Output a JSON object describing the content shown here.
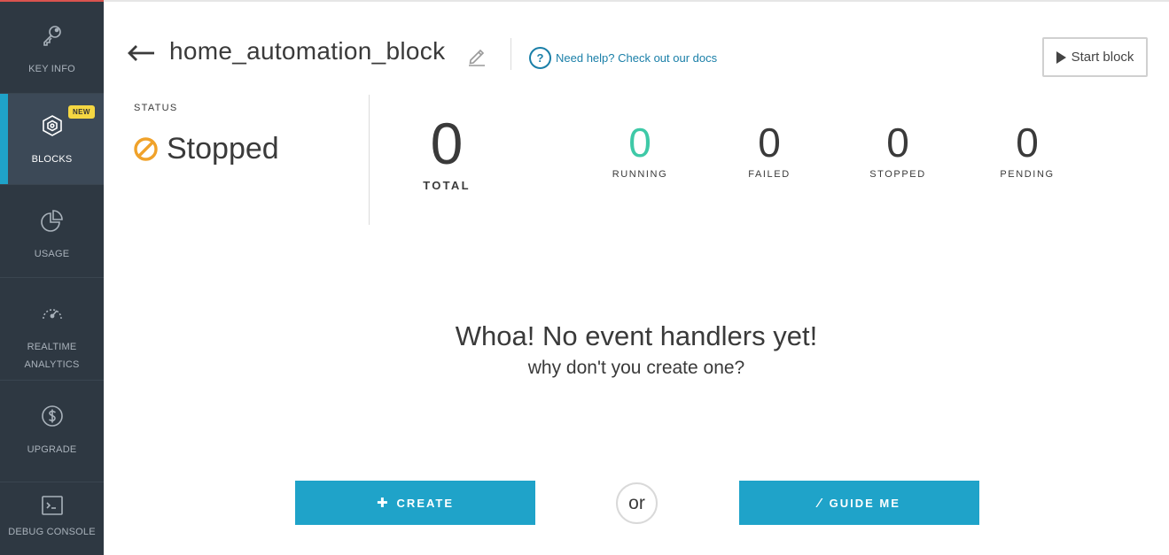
{
  "sidebar": {
    "items": [
      {
        "label": "KEY INFO",
        "icon": "key-icon"
      },
      {
        "label": "BLOCKS",
        "icon": "blocks-icon",
        "badge": "NEW",
        "active": true
      },
      {
        "label": "USAGE",
        "icon": "pie-chart-icon"
      },
      {
        "label": "REALTIME\nANALYTICS",
        "icon": "speedometer-icon"
      },
      {
        "label": "UPGRADE",
        "icon": "dollar-icon"
      },
      {
        "label": "DEBUG CONSOLE",
        "icon": "terminal-icon"
      }
    ]
  },
  "header": {
    "title": "home_automation_block",
    "help_text": "Need help? Check out our docs",
    "help_icon": "?",
    "start_button": "Start block"
  },
  "status": {
    "label": "STATUS",
    "value": "Stopped"
  },
  "stats": {
    "total": {
      "value": "0",
      "label": "TOTAL"
    },
    "running": {
      "value": "0",
      "label": "RUNNING"
    },
    "failed": {
      "value": "0",
      "label": "FAILED"
    },
    "stopped": {
      "value": "0",
      "label": "STOPPED"
    },
    "pending": {
      "value": "0",
      "label": "PENDING"
    }
  },
  "empty_state": {
    "title": "Whoa! No event handlers yet!",
    "subtitle": "why don't you create one?"
  },
  "actions": {
    "create": "CREATE",
    "or": "or",
    "guide": "GUIDE ME"
  },
  "colors": {
    "sidebar_bg": "#2e3842",
    "accent": "#1fa3c9",
    "running": "#3ec9a7",
    "stopped_icon": "#f0a22a",
    "badge": "#f5d742",
    "link": "#1a7fa8"
  }
}
